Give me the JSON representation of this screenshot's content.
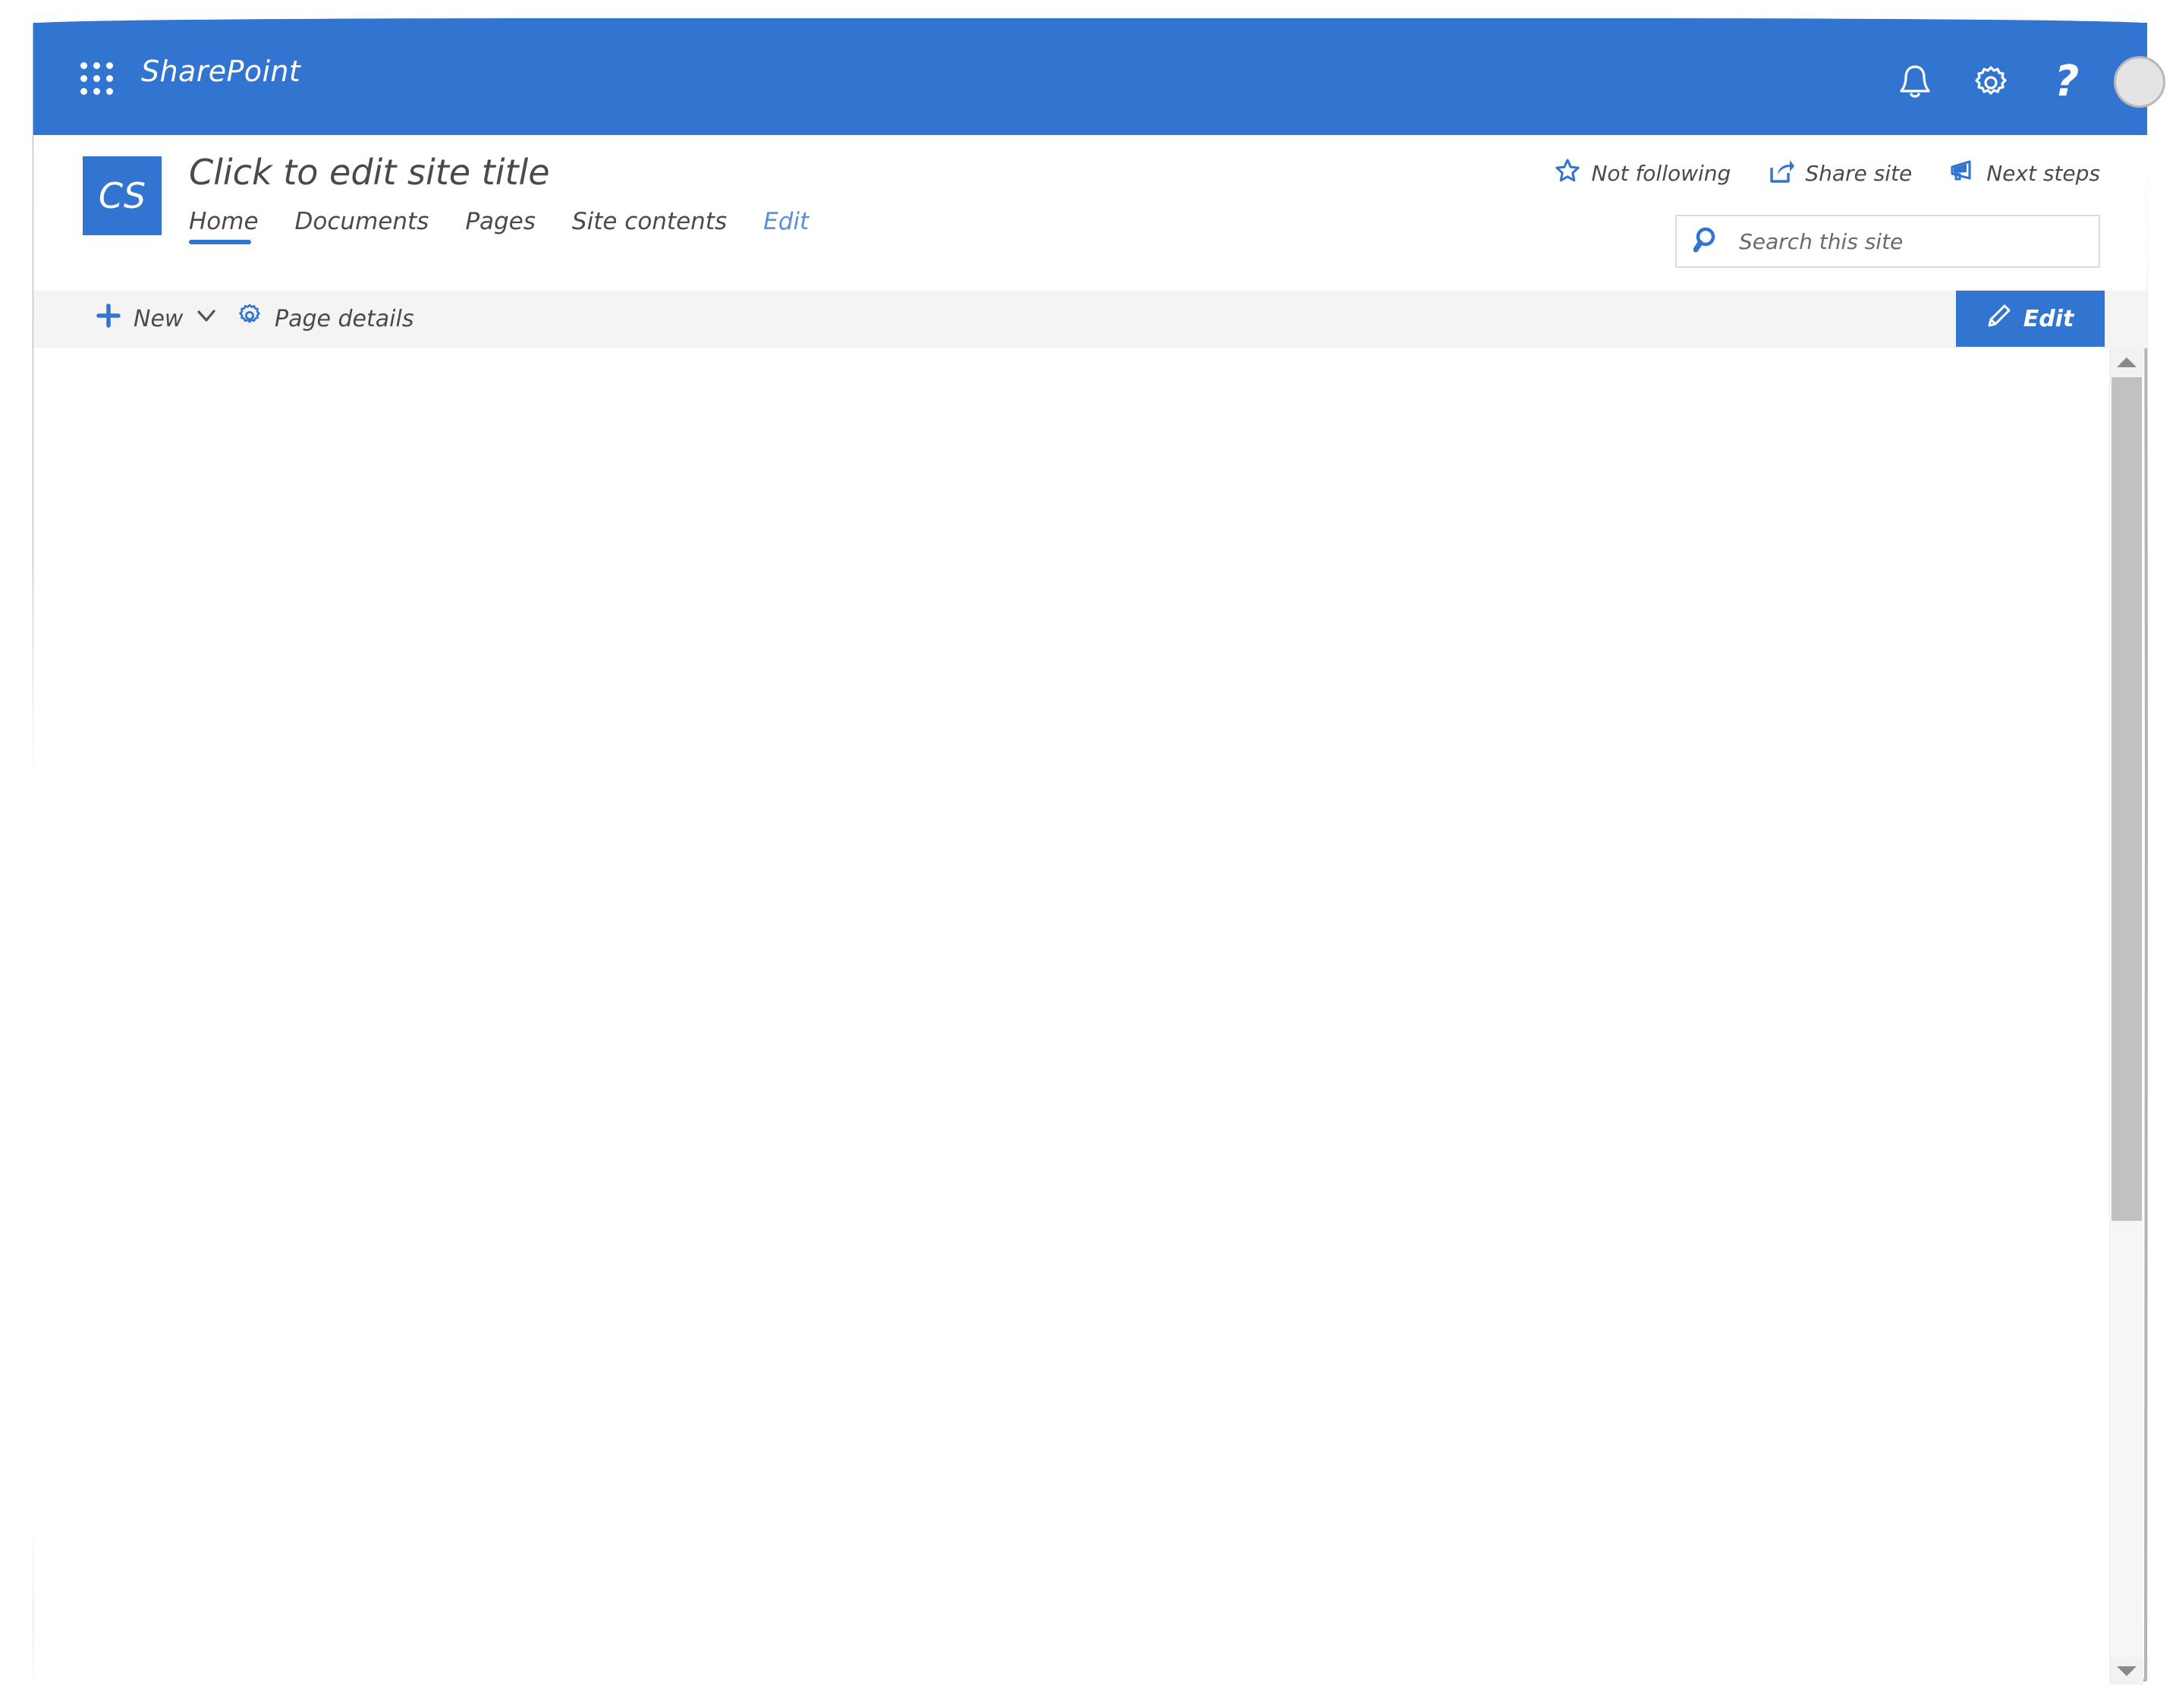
{
  "colors": {
    "brand_blue": "#3275d0",
    "command_bar_bg": "#f4f4f4",
    "text": "#4a4a48",
    "link_blue": "#5b8fd9",
    "scrollbar_thumb": "#c1c1c1",
    "avatar_bg": "#e4e4e4"
  },
  "suite_bar": {
    "app_launcher_icon": "waffle-icon",
    "title": "SharePoint",
    "icons": [
      {
        "name": "notifications-bell-icon",
        "glyph": "bell"
      },
      {
        "name": "settings-gear-icon",
        "glyph": "gear"
      },
      {
        "name": "help-icon",
        "glyph": "?"
      }
    ],
    "avatar_label": ""
  },
  "site_header": {
    "logo_initials": "CS",
    "site_title": "Click to edit site title",
    "nav": [
      {
        "label": "Home",
        "active": true,
        "style": "normal"
      },
      {
        "label": "Documents",
        "active": false,
        "style": "normal"
      },
      {
        "label": "Pages",
        "active": false,
        "style": "normal"
      },
      {
        "label": "Site contents",
        "active": false,
        "style": "normal"
      },
      {
        "label": "Edit",
        "active": false,
        "style": "link"
      }
    ],
    "actions": [
      {
        "label": "Not following",
        "icon": "star-icon"
      },
      {
        "label": "Share site",
        "icon": "share-icon"
      },
      {
        "label": "Next steps",
        "icon": "megaphone-icon"
      }
    ],
    "search": {
      "placeholder": "Search this site",
      "value": "",
      "icon": "search-icon"
    }
  },
  "command_bar": {
    "new_label": "New",
    "new_chevron_icon": "chevron-down-icon",
    "new_plus_icon": "plus-icon",
    "page_details_label": "Page details",
    "page_details_icon": "gear-icon",
    "edit_label": "Edit",
    "edit_icon": "pencil-icon"
  },
  "canvas": {
    "content": ""
  },
  "scrollbar": {
    "up_icon": "chevron-up-icon",
    "down_icon": "chevron-down-icon",
    "orientation": "vertical"
  }
}
